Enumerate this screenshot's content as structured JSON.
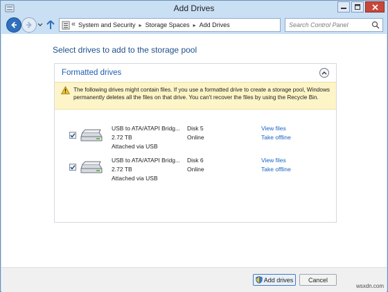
{
  "window": {
    "title": "Add Drives",
    "icon": "storage-spaces-icon"
  },
  "navigation": {
    "breadcrumb_overflow": "«",
    "breadcrumbs": [
      "System and Security",
      "Storage Spaces",
      "Add Drives"
    ],
    "search_placeholder": "Search Control Panel"
  },
  "main": {
    "heading": "Select drives to add to the storage pool",
    "section_title": "Formatted drives",
    "warning": "The following drives might contain files. If you use a formatted drive to create a storage pool, Windows permanently deletes all the files on that drive. You can't recover the files by using the Recycle Bin.",
    "drives": [
      {
        "name": "USB to ATA/ATAPI Bridg...",
        "size": "2.72 TB",
        "connection": "Attached via USB",
        "disk": "Disk 5",
        "status": "Online",
        "view_link": "View files",
        "offline_link": "Take offline",
        "checked": true
      },
      {
        "name": "USB to ATA/ATAPI Bridg...",
        "size": "2.72 TB",
        "connection": "Attached via USB",
        "disk": "Disk 6",
        "status": "Online",
        "view_link": "View files",
        "offline_link": "Take offline",
        "checked": true
      }
    ]
  },
  "footer": {
    "add_label": "Add drives",
    "cancel_label": "Cancel",
    "watermark": "wsxdn.com"
  },
  "colors": {
    "chrome": "#c9dff4",
    "heading": "#1e4e8c",
    "link": "#1a64c0",
    "warning_bg": "#fdf5c7",
    "close_button": "#c7473a"
  }
}
